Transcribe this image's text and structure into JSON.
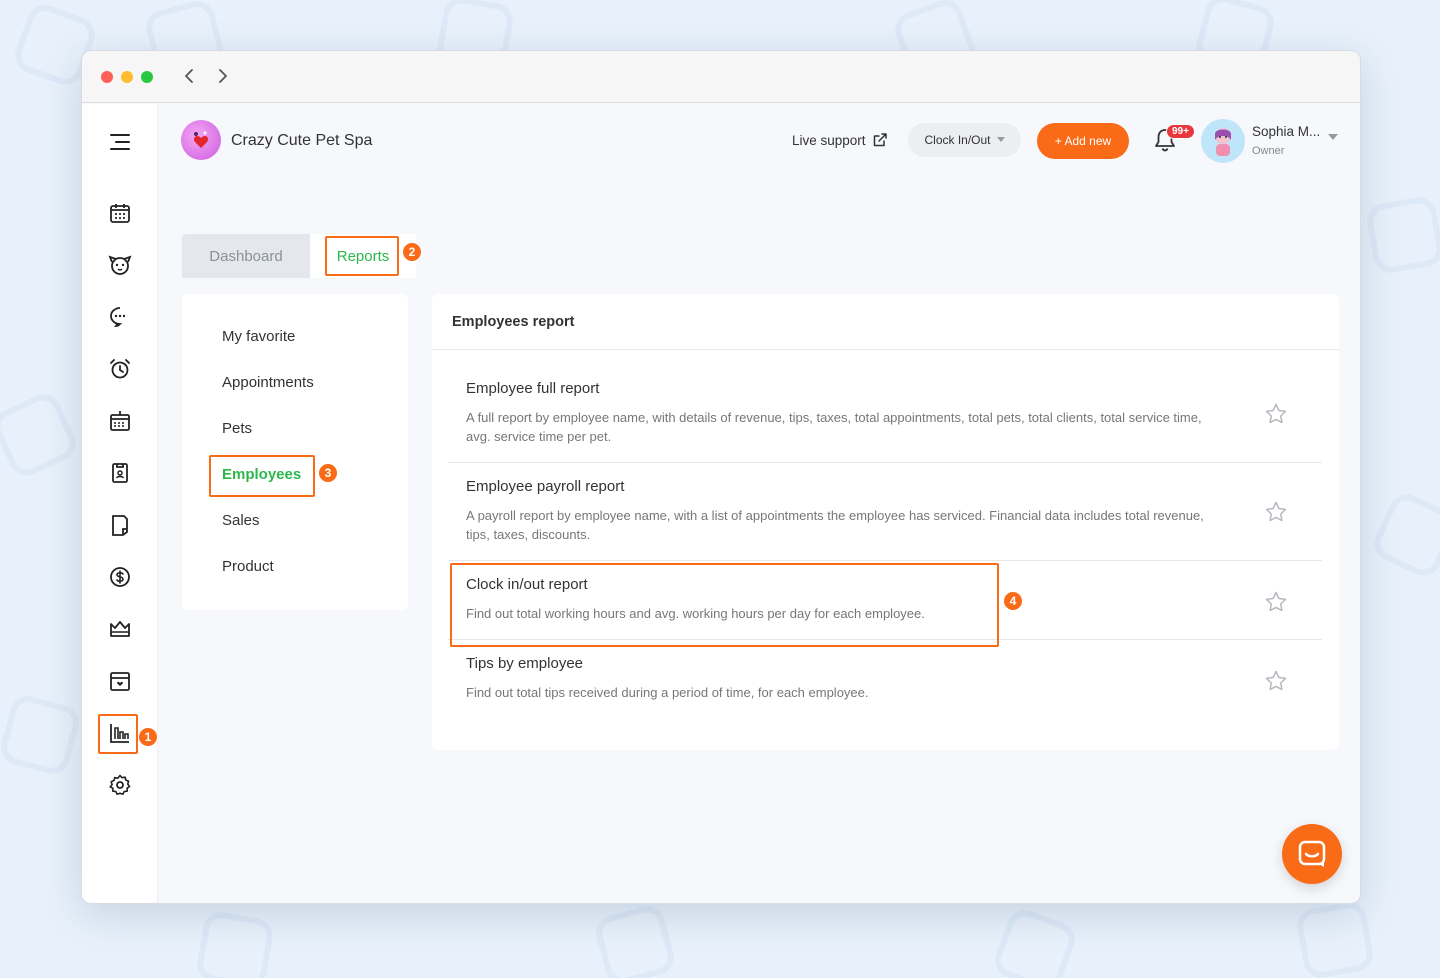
{
  "brand": {
    "name": "Crazy Cute Pet Spa"
  },
  "header": {
    "live_support": "Live support",
    "clock_button": "Clock In/Out",
    "add_button": "+ Add new",
    "notification_badge": "99+",
    "user_name": "Sophia M...",
    "user_role": "Owner"
  },
  "tabs": [
    {
      "label": "Dashboard"
    },
    {
      "label": "Reports"
    }
  ],
  "categories": [
    {
      "label": "My favorite"
    },
    {
      "label": "Appointments"
    },
    {
      "label": "Pets"
    },
    {
      "label": "Employees"
    },
    {
      "label": "Sales"
    },
    {
      "label": "Product"
    }
  ],
  "report_panel": {
    "title": "Employees report",
    "reports": [
      {
        "title": "Employee full report",
        "description": "A full report by employee name, with details of revenue, tips, taxes, total appointments, total pets, total clients, total service time, avg. service time per pet."
      },
      {
        "title": "Employee payroll report",
        "description": "A payroll report by employee name, with a list of appointments the employee has serviced. Financial data includes total revenue, tips, taxes, discounts."
      },
      {
        "title": "Clock in/out report",
        "description": "Find out total working hours and avg. working hours per day for each employee."
      },
      {
        "title": "Tips by employee",
        "description": "Find out total tips received during a period of time, for each employee."
      }
    ]
  },
  "steps": [
    "1",
    "2",
    "3",
    "4"
  ],
  "colors": {
    "accent": "#f96b17",
    "active_green": "#2db84d",
    "badge_red": "#e8383d"
  },
  "sidebar_icons": [
    "menu-icon",
    "calendar-icon",
    "pet-icon",
    "chat-icon",
    "alarm-icon",
    "schedule-icon",
    "badge-icon",
    "document-icon",
    "dollar-icon",
    "crown-icon",
    "calendar-heart-icon",
    "reports-chart-icon",
    "settings-icon"
  ]
}
